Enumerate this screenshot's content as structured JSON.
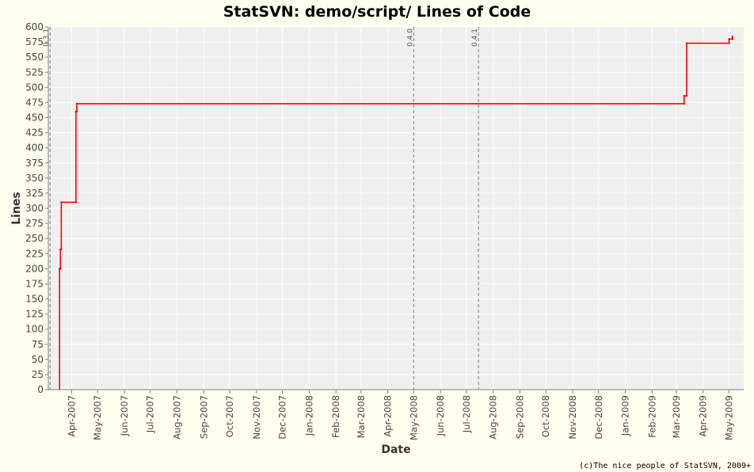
{
  "chart_data": {
    "type": "line",
    "title": "StatSVN: demo/script/ Lines of Code",
    "xlabel": "Date",
    "ylabel": "Lines",
    "ylim": [
      0,
      600
    ],
    "yticks": [
      0,
      25,
      50,
      75,
      100,
      125,
      150,
      175,
      200,
      225,
      250,
      275,
      300,
      325,
      350,
      375,
      400,
      425,
      450,
      475,
      500,
      525,
      550,
      575,
      600
    ],
    "xlim": [
      "2007-03-05",
      "2009-05-18"
    ],
    "xticks": [
      {
        "date": "2007-04-01",
        "label": "Apr-2007"
      },
      {
        "date": "2007-05-01",
        "label": "May-2007"
      },
      {
        "date": "2007-06-01",
        "label": "Jun-2007"
      },
      {
        "date": "2007-07-01",
        "label": "Jul-2007"
      },
      {
        "date": "2007-08-01",
        "label": "Aug-2007"
      },
      {
        "date": "2007-09-01",
        "label": "Sep-2007"
      },
      {
        "date": "2007-10-01",
        "label": "Oct-2007"
      },
      {
        "date": "2007-11-01",
        "label": "Nov-2007"
      },
      {
        "date": "2007-12-01",
        "label": "Dec-2007"
      },
      {
        "date": "2008-01-01",
        "label": "Jan-2008"
      },
      {
        "date": "2008-02-01",
        "label": "Feb-2008"
      },
      {
        "date": "2008-03-01",
        "label": "Mar-2008"
      },
      {
        "date": "2008-04-01",
        "label": "Apr-2008"
      },
      {
        "date": "2008-05-01",
        "label": "May-2008"
      },
      {
        "date": "2008-06-01",
        "label": "Jun-2008"
      },
      {
        "date": "2008-07-01",
        "label": "Jul-2008"
      },
      {
        "date": "2008-08-01",
        "label": "Aug-2008"
      },
      {
        "date": "2008-09-01",
        "label": "Sep-2008"
      },
      {
        "date": "2008-10-01",
        "label": "Oct-2008"
      },
      {
        "date": "2008-11-01",
        "label": "Nov-2008"
      },
      {
        "date": "2008-12-01",
        "label": "Dec-2008"
      },
      {
        "date": "2009-01-01",
        "label": "Jan-2009"
      },
      {
        "date": "2009-02-01",
        "label": "Feb-2009"
      },
      {
        "date": "2009-03-01",
        "label": "Mar-2009"
      },
      {
        "date": "2009-04-01",
        "label": "Apr-2009"
      },
      {
        "date": "2009-05-01",
        "label": "May-2009"
      }
    ],
    "markers": [
      {
        "date": "2007-03-07",
        "label": "0.3.1"
      },
      {
        "date": "2008-05-01",
        "label": "0.4.0"
      },
      {
        "date": "2008-07-15",
        "label": "0.4.1"
      }
    ],
    "series": [
      {
        "color": "#ff0000",
        "step": true,
        "points": [
          {
            "x": "2007-03-18",
            "y": 0
          },
          {
            "x": "2007-03-18",
            "y": 200
          },
          {
            "x": "2007-03-19",
            "y": 200
          },
          {
            "x": "2007-03-19",
            "y": 232
          },
          {
            "x": "2007-03-20",
            "y": 232
          },
          {
            "x": "2007-03-20",
            "y": 310
          },
          {
            "x": "2007-04-06",
            "y": 310
          },
          {
            "x": "2007-04-06",
            "y": 460
          },
          {
            "x": "2007-04-07",
            "y": 460
          },
          {
            "x": "2007-04-07",
            "y": 473
          },
          {
            "x": "2009-03-10",
            "y": 473
          },
          {
            "x": "2009-03-10",
            "y": 486
          },
          {
            "x": "2009-03-13",
            "y": 486
          },
          {
            "x": "2009-03-13",
            "y": 573
          },
          {
            "x": "2009-05-01",
            "y": 573
          },
          {
            "x": "2009-05-01",
            "y": 580
          },
          {
            "x": "2009-05-05",
            "y": 580
          },
          {
            "x": "2009-05-05",
            "y": 584
          }
        ]
      }
    ]
  },
  "footer": "(c)The nice people of StatSVN, 2009+"
}
